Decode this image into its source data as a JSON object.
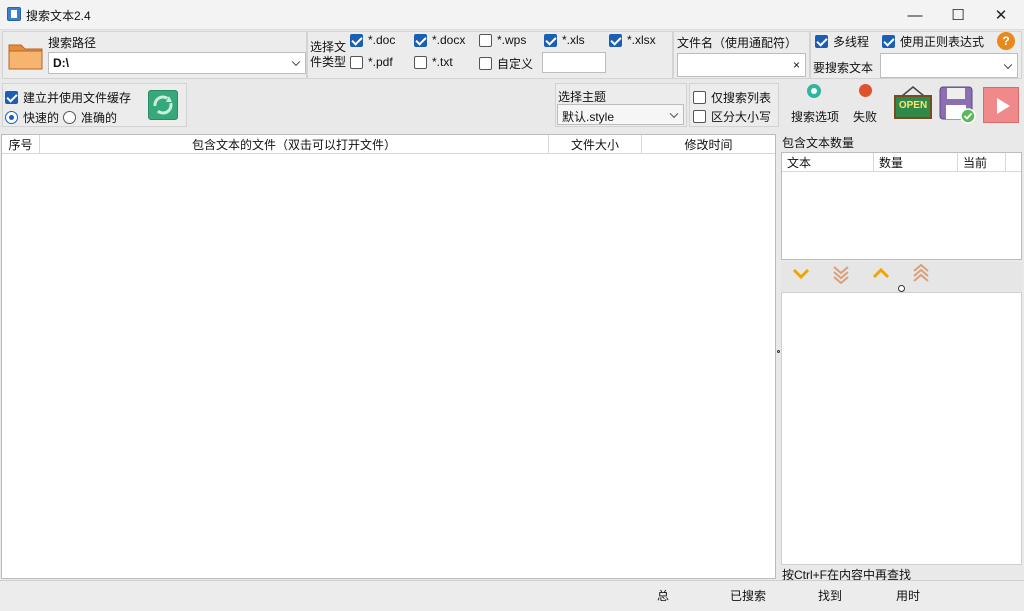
{
  "window": {
    "title": "搜索文本2.4",
    "minimize": "—",
    "maximize": "☐",
    "close": "✕"
  },
  "search_path": {
    "label": "搜索路径",
    "value": "D:\\"
  },
  "file_types": {
    "label": "选择文件类型",
    "items": [
      {
        "label": "*.doc",
        "checked": true
      },
      {
        "label": "*.docx",
        "checked": true
      },
      {
        "label": "*.wps",
        "checked": false
      },
      {
        "label": "*.xls",
        "checked": true
      },
      {
        "label": "*.xlsx",
        "checked": true
      },
      {
        "label": "*.pdf",
        "checked": false
      },
      {
        "label": "*.txt",
        "checked": false
      },
      {
        "label": "自定义",
        "checked": false
      }
    ],
    "custom_value": ""
  },
  "filename": {
    "label": "文件名（使用通配符）",
    "value": "",
    "clear": "×"
  },
  "options": {
    "multithread": {
      "label": "多线程",
      "checked": true
    },
    "regex": {
      "label": "使用正则表达式",
      "checked": true
    },
    "help": "?"
  },
  "search_text": {
    "label": "要搜索文本",
    "value": ""
  },
  "cache": {
    "label": "建立并使用文件缓存",
    "checked": true,
    "fast": "快速的",
    "accurate": "准确的",
    "mode": "fast"
  },
  "theme": {
    "label": "选择主题",
    "value": "默认.style"
  },
  "search_list_only": {
    "label": "仅搜索列表",
    "checked": false
  },
  "case_sensitive": {
    "label": "区分大小写",
    "checked": false
  },
  "search_options": {
    "label": "搜索选项"
  },
  "fail": {
    "label": "失败"
  },
  "open_sign": "OPEN",
  "results_table": {
    "columns": [
      "序号",
      "包含文本的文件（双击可以打开文件）",
      "文件大小",
      "修改时间"
    ],
    "rows": []
  },
  "count_panel": {
    "title": "包含文本数量",
    "columns": [
      "文本",
      "数量",
      "当前"
    ],
    "rows": []
  },
  "hint": "按Ctrl+F在内容中再查找",
  "status": {
    "total": "总",
    "searched": "已搜索",
    "found": "找到",
    "elapsed": "用时"
  },
  "colors": {
    "accent": "#1b5fb5",
    "folder": "#f2a35a",
    "refresh": "#37a879",
    "play": "#f08a8a"
  }
}
